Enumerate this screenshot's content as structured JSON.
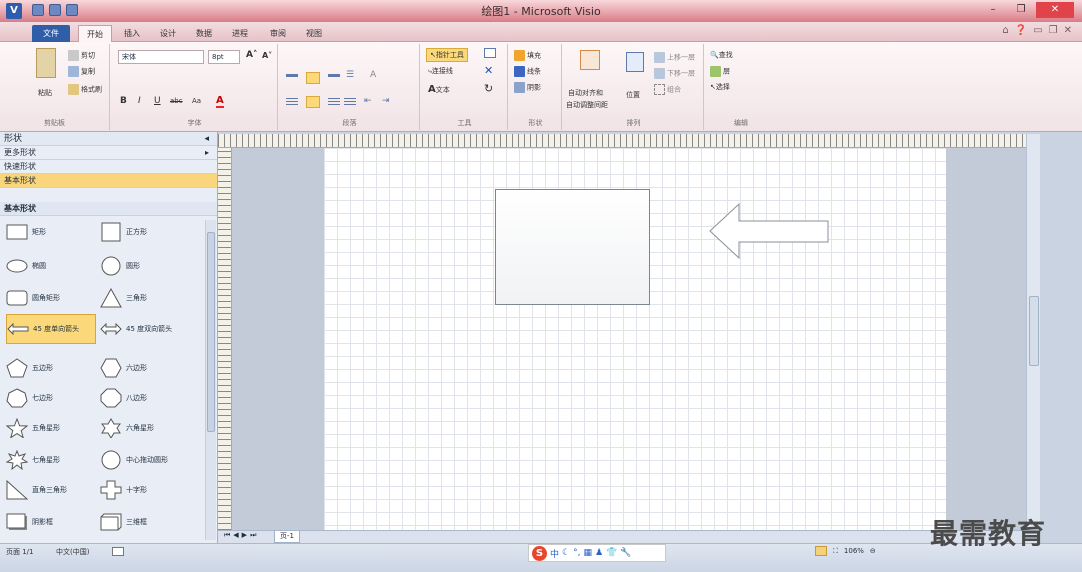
{
  "window": {
    "title": "绘图1 - Microsoft Visio",
    "logo": "V",
    "minimize": "–",
    "maximize": "❐",
    "close": "✕"
  },
  "tabs": [
    {
      "label": "文件"
    },
    {
      "label": "开始"
    },
    {
      "label": "插入"
    },
    {
      "label": "设计"
    },
    {
      "label": "数据"
    },
    {
      "label": "进程"
    },
    {
      "label": "审阅"
    },
    {
      "label": "视图"
    }
  ],
  "ribbon": {
    "clipboard": {
      "paste": "粘贴",
      "cut": "剪切",
      "copy": "复制",
      "format_painter": "格式刷",
      "label": "剪贴板"
    },
    "font": {
      "name": "宋体",
      "size": "8pt",
      "grow": "A˄",
      "shrink": "A˅",
      "bold": "B",
      "italic": "I",
      "underline": "U",
      "strike": "abc",
      "case": "Aa",
      "color": "A",
      "label": "字体"
    },
    "paragraph": {
      "label": "段落"
    },
    "tools": {
      "pointer": "指针工具",
      "connector": "连接线",
      "text": "文本",
      "label": "工具"
    },
    "shape": {
      "fill": "填充",
      "line": "线条",
      "shadow": "阴影",
      "label": "形状"
    },
    "arrange": {
      "align": "自动对齐和",
      "spacing": "自动调整间距",
      "position": "位置",
      "bring_forward": "上移一层",
      "send_backward": "下移一层",
      "group": "组合",
      "label": "排列"
    },
    "editing": {
      "find": "查找",
      "layers": "层",
      "select": "选择",
      "label": "编辑"
    }
  },
  "shapes_panel": {
    "title": "形状",
    "more": "更多形状",
    "quick": "快速形状",
    "basic_selected": "基本形状",
    "basic_header": "基本形状",
    "items": [
      {
        "label": "矩形",
        "icon": "rectangle-icon"
      },
      {
        "label": "正方形",
        "icon": "square-icon"
      },
      {
        "label": "椭圆",
        "icon": "ellipse-icon"
      },
      {
        "label": "圆形",
        "icon": "circle-icon"
      },
      {
        "label": "圆角矩形",
        "icon": "rounded-rectangle-icon"
      },
      {
        "label": "三角形",
        "icon": "triangle-icon"
      },
      {
        "label": "45 度单向箭头",
        "icon": "single-arrow-icon"
      },
      {
        "label": "45 度双向箭头",
        "icon": "double-arrow-icon"
      },
      {
        "label": "五边形",
        "icon": "pentagon-icon"
      },
      {
        "label": "六边形",
        "icon": "hexagon-icon"
      },
      {
        "label": "七边形",
        "icon": "heptagon-icon"
      },
      {
        "label": "八边形",
        "icon": "octagon-icon"
      },
      {
        "label": "五角星形",
        "icon": "five-star-icon"
      },
      {
        "label": "六角星形",
        "icon": "six-star-icon"
      },
      {
        "label": "七角星形",
        "icon": "seven-star-icon"
      },
      {
        "label": "中心拖动圆形",
        "icon": "center-drag-circle-icon"
      },
      {
        "label": "直角三角形",
        "icon": "right-triangle-icon"
      },
      {
        "label": "十字形",
        "icon": "cross-icon"
      },
      {
        "label": "阴影框",
        "icon": "shadow-box-icon"
      },
      {
        "label": "三维框",
        "icon": "3d-box-icon"
      }
    ]
  },
  "page_tab": "页-1",
  "status": {
    "page": "页面 1/1",
    "language": "中文(中国)",
    "zoom": "106%"
  },
  "watermark": "最需教育",
  "colors": {
    "file_tab": "#2f5da8",
    "selected": "#fbd97a",
    "title_bar": "#e8a6ad"
  }
}
